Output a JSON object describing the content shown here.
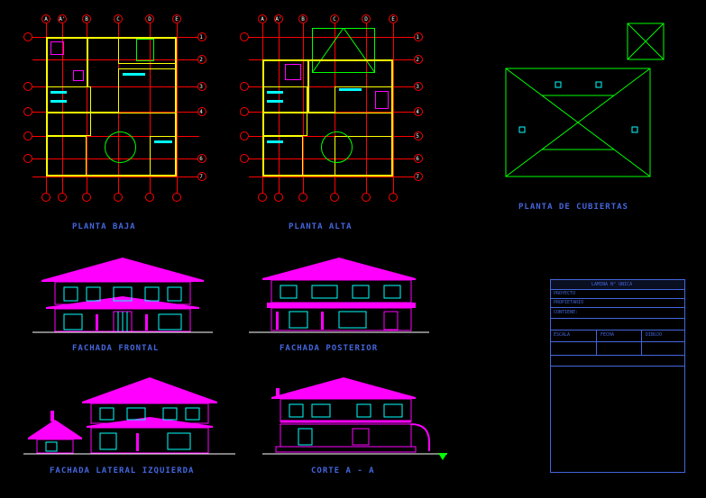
{
  "drawings": {
    "planta_baja": {
      "label": "PLANTA BAJA"
    },
    "planta_alta": {
      "label": "PLANTA ALTA"
    },
    "planta_cubiertas": {
      "label": "PLANTA DE CUBIERTAS"
    },
    "fachada_frontal": {
      "label": "FACHADA FRONTAL"
    },
    "fachada_posterior": {
      "label": "FACHADA POSTERIOR"
    },
    "fachada_lateral": {
      "label": "FACHADA LATERAL IZQUIERDA"
    },
    "corte_aa": {
      "label": "CORTE A - A"
    }
  },
  "grid": {
    "cols": [
      "A",
      "A'",
      "B",
      "C",
      "D",
      "E"
    ],
    "rows": [
      "1",
      "2",
      "3",
      "4",
      "5",
      "6",
      "7"
    ]
  },
  "title_block": {
    "header": "LAMINA N° UNICA",
    "project": "PROYECTO",
    "owner": "PROPIETARIO",
    "content": "CONTIENE:",
    "scale": "ESCALA",
    "date": "FECHA",
    "drawn": "DIBUJO"
  },
  "colors": {
    "grid": "#ff0000",
    "walls": "#ffff00",
    "roof": "#00ff00",
    "interior": "#00ffff",
    "elevation": "#ff00ff",
    "text": "#4466dd",
    "ground": "#ffffff"
  }
}
